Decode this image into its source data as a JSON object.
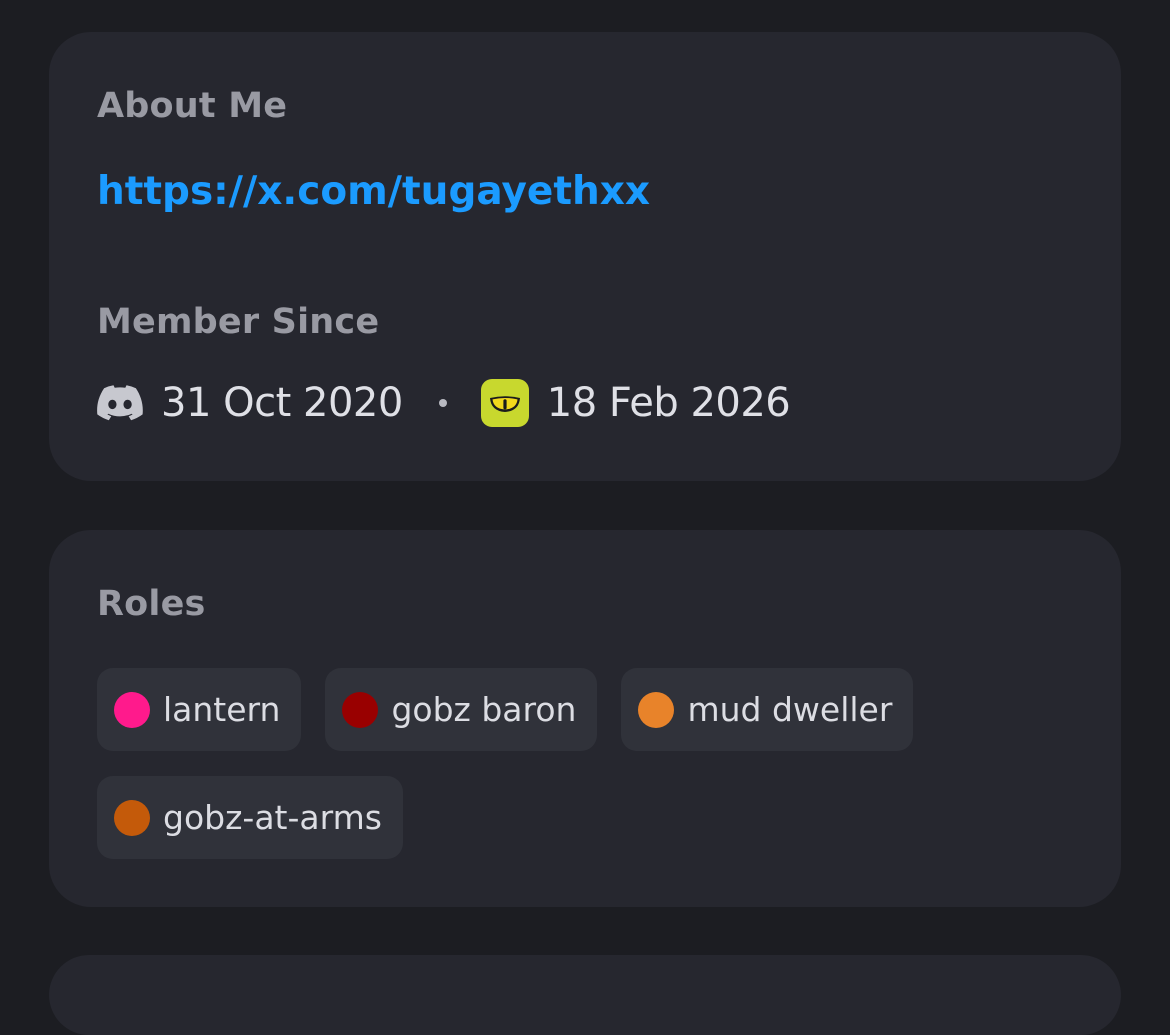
{
  "about": {
    "label": "About Me",
    "link": "https://x.com/tugayethxx"
  },
  "member_since": {
    "label": "Member Since",
    "discord_icon": "discord-icon",
    "discord_date": "31 Oct 2020",
    "server_icon": "server-icon",
    "server_date": "18 Feb 2026"
  },
  "roles": {
    "label": "Roles",
    "items": [
      {
        "name": "lantern",
        "color": "#ff1a8c"
      },
      {
        "name": "gobz baron",
        "color": "#990000"
      },
      {
        "name": "mud dweller",
        "color": "#e8832a"
      },
      {
        "name": "gobz-at-arms",
        "color": "#c45a0a"
      }
    ]
  },
  "colors": {
    "background": "#1c1d22",
    "card": "#26272f",
    "link": "#1b9bff",
    "label": "#999aa3"
  }
}
